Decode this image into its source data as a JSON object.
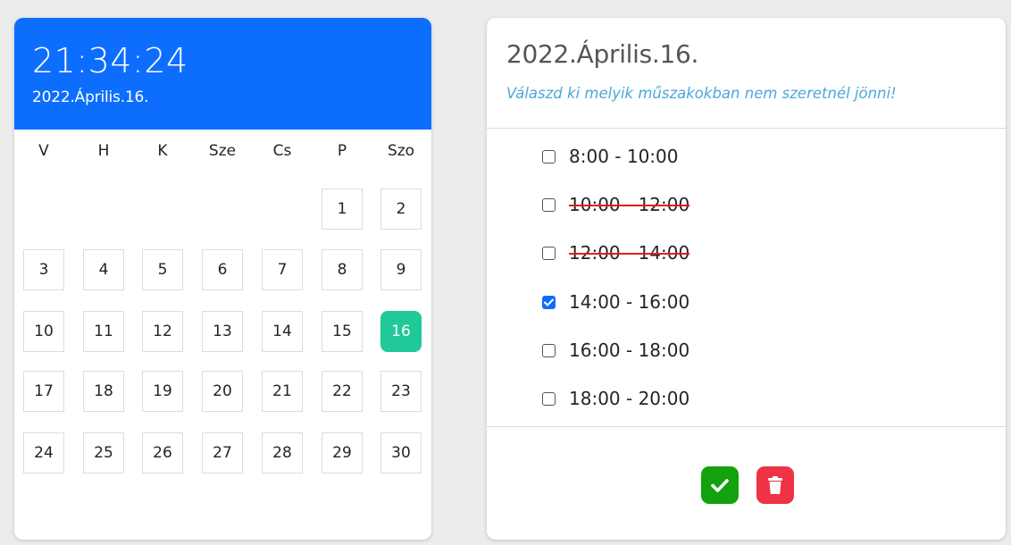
{
  "calendar": {
    "time": "21:34:24",
    "date": "2022.Április.16.",
    "weekdays": [
      "V",
      "H",
      "K",
      "Sze",
      "Cs",
      "P",
      "Szo"
    ],
    "days": [
      "1",
      "2",
      "3",
      "4",
      "5",
      "6",
      "7",
      "8",
      "9",
      "10",
      "11",
      "12",
      "13",
      "14",
      "15",
      "16",
      "17",
      "18",
      "19",
      "20",
      "21",
      "22",
      "23",
      "24",
      "25",
      "26",
      "27",
      "28",
      "29",
      "30"
    ],
    "selected_day": "16",
    "accent_color": "#0d6efd",
    "selected_color": "#20c997"
  },
  "shifts": {
    "title": "2022.Április.16.",
    "subtitle": "Válaszd ki melyik műszakokban nem szeretnél jönni!",
    "items": [
      {
        "label": "8:00 - 10:00",
        "checked": false,
        "struck": false
      },
      {
        "label": "10:00 - 12:00",
        "checked": false,
        "struck": true
      },
      {
        "label": "12:00 - 14:00",
        "checked": false,
        "struck": true
      },
      {
        "label": "14:00 - 16:00",
        "checked": true,
        "struck": false
      },
      {
        "label": "16:00 - 18:00",
        "checked": false,
        "struck": false
      },
      {
        "label": "18:00 - 20:00",
        "checked": false,
        "struck": false
      }
    ],
    "confirm_icon": "check-icon",
    "delete_icon": "trash-icon",
    "confirm_color": "#13a10e",
    "delete_color": "#ee3344"
  }
}
